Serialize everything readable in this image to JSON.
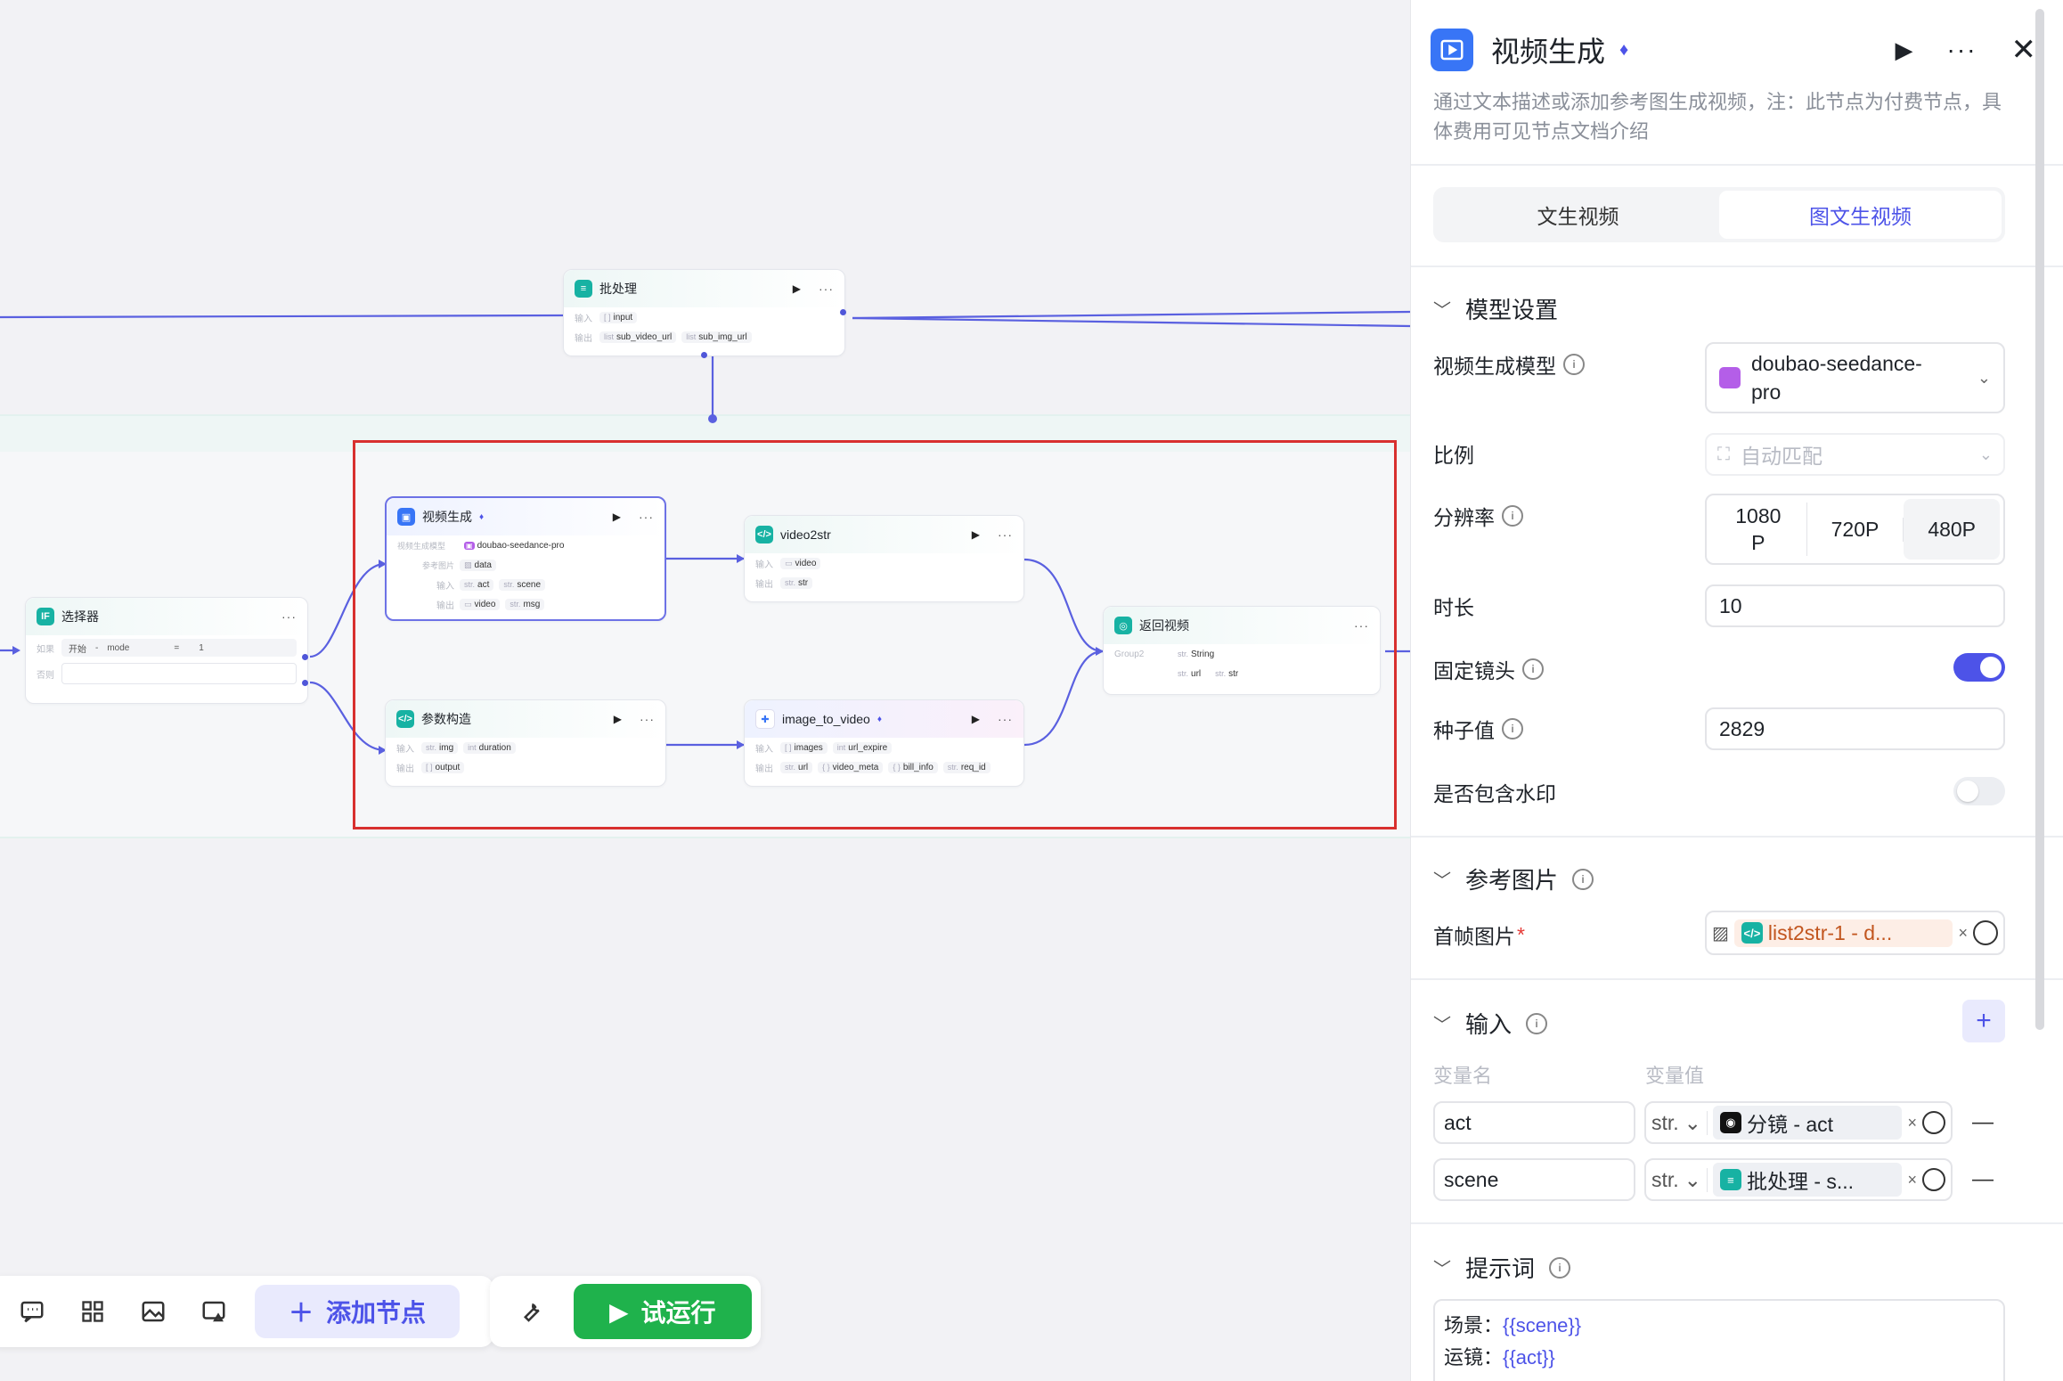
{
  "canvas": {
    "batch_node": {
      "title": "批处理",
      "in_label": "输入",
      "in_tag_type": "[ ]",
      "in_tag": "input",
      "out_label": "输出",
      "out_tag1_type": "list",
      "out_tag1": "sub_video_url",
      "out_tag2_type": "list",
      "out_tag2": "sub_img_url"
    },
    "selector_node": {
      "title": "选择器",
      "if_label": "如果",
      "cond_left": "开始",
      "cond_sep": "-",
      "cond_var": "mode",
      "cond_op": "=",
      "cond_val": "1",
      "else_label": "否则"
    },
    "video_gen_node": {
      "title": "视频生成",
      "model_label": "视频生成模型",
      "model_value": "doubao-seedance-pro",
      "ref_label": "参考图片",
      "ref_value": "data",
      "in_label": "输入",
      "in_tag1_type": "str.",
      "in_tag1": "act",
      "in_tag2_type": "str.",
      "in_tag2": "scene",
      "out_label": "输出",
      "out_tag1": "video",
      "out_tag2_type": "str.",
      "out_tag2": "msg"
    },
    "video2str_node": {
      "title": "video2str",
      "in_label": "输入",
      "in_tag": "video",
      "out_label": "输出",
      "out_tag_type": "str.",
      "out_tag": "str"
    },
    "param_node": {
      "title": "参数构造",
      "in_label": "输入",
      "in_tag1_type": "str.",
      "in_tag1": "img",
      "in_tag2_type": "int",
      "in_tag2": "duration",
      "out_label": "输出",
      "out_tag_type": "[ ]",
      "out_tag": "output"
    },
    "i2v_node": {
      "title": "image_to_video",
      "in_label": "输入",
      "in_tag1_type": "[ ]",
      "in_tag1": "images",
      "in_tag2_type": "int",
      "in_tag2": "url_expire",
      "out_label": "输出",
      "out_tag1_type": "str.",
      "out_tag1": "url",
      "out_tag2_type": "{ }",
      "out_tag2": "video_meta",
      "out_tag3_type": "{ }",
      "out_tag3": "bill_info",
      "out_tag4_type": "str.",
      "out_tag4": "req_id"
    },
    "return_node": {
      "title": "返回视频",
      "group_label": "Group2",
      "tag1_type": "str.",
      "tag1": "String",
      "tag2_type": "str.",
      "tag2": "url",
      "tag3_type": "str.",
      "tag3": "str"
    }
  },
  "toolbar": {
    "add_node": "添加节点",
    "test_run": "试运行"
  },
  "panel": {
    "title": "视频生成",
    "description": "通过文本描述或添加参考图生成视频，注：此节点为付费节点，具体费用可见节点文档介绍",
    "tabs": [
      "文生视频",
      "图文生视频"
    ],
    "model_section": "模型设置",
    "model_label": "视频生成模型",
    "model_value_line1": "doubao-seedance-",
    "model_value_line2": "pro",
    "ratio_label": "比例",
    "ratio_value": "自动匹配",
    "resolution_label": "分辨率",
    "resolution_options": [
      "1080\nP",
      "720P",
      "480P"
    ],
    "duration_label": "时长",
    "duration_value": "10",
    "fixed_camera_label": "固定镜头",
    "fixed_camera_on": true,
    "seed_label": "种子值",
    "seed_value": "2829",
    "watermark_label": "是否包含水印",
    "watermark_on": false,
    "ref_section": "参考图片",
    "first_frame_label": "首帧图片",
    "required_mark": "*",
    "first_frame_ref": "list2str-1 - d...",
    "input_section": "输入",
    "col_name": "变量名",
    "col_value": "变量值",
    "inputs": [
      {
        "name": "act",
        "type": "str.",
        "ref": "分镜 - act"
      },
      {
        "name": "scene",
        "type": "str.",
        "ref": "批处理 - s..."
      }
    ],
    "prompt_section": "提示词",
    "prompt_line1_label": "场景：",
    "prompt_line1_var": "{{scene}}",
    "prompt_line2_label": "运镜：",
    "prompt_line2_var": "{{act}}"
  },
  "colors": {
    "accent": "#4d53e8",
    "green": "#1fb24c",
    "selection": "#d8302f",
    "teal": "#17b2a3"
  }
}
